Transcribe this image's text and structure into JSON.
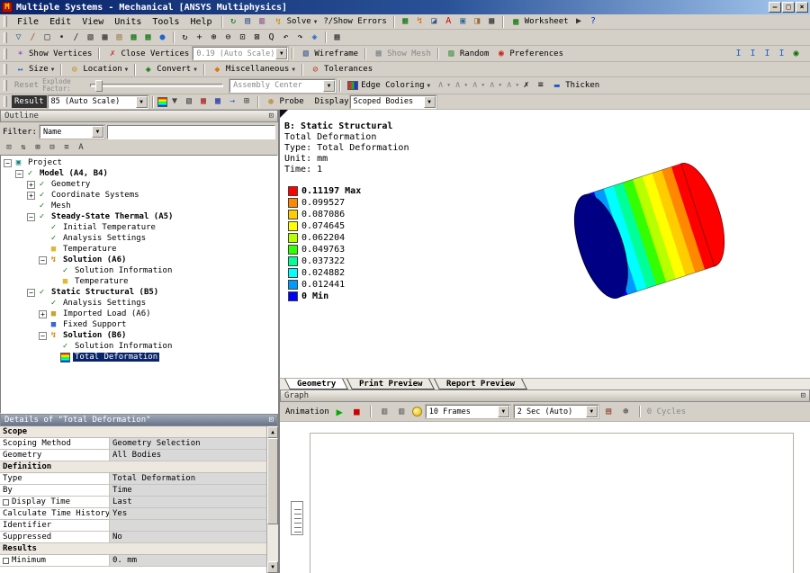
{
  "window": {
    "title": "Multiple Systems - Mechanical [ANSYS Multiphysics]"
  },
  "menus": [
    "File",
    "Edit",
    "View",
    "Units",
    "Tools",
    "Help"
  ],
  "toolbars": {
    "main": {
      "solve": "Solve",
      "show_errors": "?/Show Errors",
      "worksheet": "Worksheet"
    },
    "vertices": {
      "show_vertices": "Show Vertices",
      "close_vertices": "Close Vertices",
      "scale": "0.19 (Auto Scale)",
      "wireframe": "Wireframe",
      "show_mesh": "Show Mesh",
      "random": "Random",
      "preferences": "Preferences"
    },
    "selection": {
      "size": "Size",
      "location": "Location",
      "convert": "Convert",
      "miscellaneous": "Miscellaneous",
      "tolerances": "Tolerances"
    },
    "explode": {
      "reset": "Reset",
      "factor_label": "Explode Factor:",
      "assembly": "Assembly Center",
      "edge_coloring": "Edge Coloring",
      "thicken": "Thicken"
    },
    "result": {
      "label": "Result",
      "scale": "85 (Auto Scale)",
      "probe": "Probe",
      "display": "Display",
      "display_value": "Scoped Bodies"
    }
  },
  "icons": {
    "r1a": [
      {
        "n": "model-refresh-icon",
        "g": "↻",
        "f": "#067106"
      },
      {
        "n": "insert-object-icon",
        "g": "▤",
        "f": "#335588"
      },
      {
        "n": "chart-view-icon",
        "g": "▥",
        "f": "#884488"
      }
    ],
    "r1b": [
      {
        "n": "tools-grid-icon",
        "g": "▦",
        "f": "#067106"
      },
      {
        "n": "bolt-tool-icon",
        "g": "↯",
        "f": "#cc6600"
      },
      {
        "n": "section-plane-icon",
        "g": "◪",
        "f": "#335588"
      },
      {
        "n": "annotation-icon",
        "g": "A",
        "f": "#cc0000"
      },
      {
        "n": "snapshot-icon",
        "g": "▣",
        "f": "#336699"
      },
      {
        "n": "units-tag-icon",
        "g": "◨",
        "f": "#996633"
      },
      {
        "n": "report-chart-icon",
        "g": "▩",
        "f": "#333333"
      }
    ],
    "r1c": [
      {
        "n": "pointer-mode-icon",
        "g": "▶",
        "f": "#333333"
      },
      {
        "n": "what-is-this-icon",
        "g": "?",
        "f": "#0033cc"
      }
    ],
    "r2": [
      {
        "n": "filter-icon",
        "g": "▽",
        "f": "#336699"
      },
      {
        "n": "edit-pencil-icon",
        "g": "∕",
        "f": "#996633"
      },
      {
        "n": "select-mode-icon",
        "g": "□",
        "f": "#333333"
      },
      {
        "n": "vertex-filter-icon",
        "g": "∙",
        "f": "#333333"
      },
      {
        "n": "edge-filter-icon",
        "g": "/",
        "f": "#333333"
      },
      {
        "n": "face-filter-icon",
        "g": "▧",
        "f": "#333333"
      },
      {
        "n": "body-filter-icon",
        "g": "▩",
        "f": "#333333"
      },
      {
        "n": "clipboard-copy-icon",
        "g": "▤",
        "f": "#997744"
      },
      {
        "n": "selection-table-icon",
        "g": "▦",
        "f": "#067106"
      },
      {
        "n": "selection-info-icon",
        "g": "▦",
        "f": "#067106"
      },
      {
        "n": "globe-icon",
        "g": "●",
        "f": "#2266cc"
      },
      {
        "sep": 1
      },
      {
        "n": "rotate-view-icon",
        "g": "↻",
        "f": "#111111"
      },
      {
        "n": "pan-view-icon",
        "g": "+",
        "f": "#111111"
      },
      {
        "n": "zoom-in-icon",
        "g": "⊕",
        "f": "#111111"
      },
      {
        "n": "zoom-out-icon",
        "g": "⊖",
        "f": "#111111"
      },
      {
        "n": "box-zoom-icon",
        "g": "⊡",
        "f": "#111111"
      },
      {
        "n": "zoom-fit-icon",
        "g": "⊠",
        "f": "#111111"
      },
      {
        "n": "magnifier-icon",
        "g": "Q",
        "f": "#111111"
      },
      {
        "n": "previous-view-icon",
        "g": "↶",
        "f": "#111111"
      },
      {
        "n": "next-view-icon",
        "g": "↷",
        "f": "#111111"
      },
      {
        "n": "iso-view-icon",
        "g": "◈",
        "f": "#2266cc"
      },
      {
        "sep": 1
      },
      {
        "n": "viewports-icon",
        "g": "▦",
        "f": "#333333"
      }
    ],
    "r3r": [
      {
        "n": "beam-display-icon",
        "g": "I",
        "f": "#2266cc"
      },
      {
        "n": "beam-section-icon",
        "g": "I",
        "f": "#2266cc"
      },
      {
        "n": "beam-orientation-icon",
        "g": "I",
        "f": "#2266cc"
      },
      {
        "n": "beam-results-icon",
        "g": "I",
        "f": "#2266cc"
      },
      {
        "n": "connections-icon",
        "g": "◉",
        "f": "#067106"
      }
    ],
    "r6": [
      {
        "n": "contour-bands-icon",
        "rainbow": 1
      },
      {
        "n": "contour-mode-icon",
        "g": "▼",
        "f": "#444444"
      },
      {
        "n": "geometry-display-icon",
        "g": "▧",
        "f": "#444444"
      },
      {
        "n": "max-annotation-icon",
        "g": "▦",
        "f": "#aa2222"
      },
      {
        "n": "min-annotation-icon",
        "g": "▦",
        "f": "#2233aa"
      },
      {
        "n": "vector-plot-icon",
        "g": "→",
        "f": "#2266cc"
      },
      {
        "n": "solution-combo-icon",
        "g": "⊞",
        "f": "#444444"
      }
    ],
    "outline_tools": [
      {
        "n": "show-details-icon",
        "g": "⊡",
        "f": "#333333"
      },
      {
        "n": "sort-items-icon",
        "g": "⇅",
        "f": "#333333"
      },
      {
        "n": "expand-all-icon",
        "g": "⊞",
        "f": "#333333"
      },
      {
        "n": "collapse-all-icon",
        "g": "⊟",
        "f": "#333333"
      },
      {
        "n": "flat-view-icon",
        "g": "≡",
        "f": "#333333"
      },
      {
        "n": "name-sort-icon",
        "g": "A",
        "f": "#333333"
      }
    ]
  },
  "tree_icon_defs": {
    "project": {
      "g": "▣",
      "f": "#18867e"
    },
    "model": {
      "g": "✓",
      "f": "#067106"
    },
    "geometry": {
      "g": "✓",
      "f": "#067106"
    },
    "csys": {
      "g": "✓",
      "f": "#067106"
    },
    "mesh": {
      "g": "✓",
      "f": "#067106"
    },
    "thermal": {
      "g": "✓",
      "f": "#067106"
    },
    "inittemp": {
      "g": "✓",
      "f": "#067106"
    },
    "settings": {
      "g": "✓",
      "f": "#067106"
    },
    "tempload": {
      "g": "■",
      "f": "#e0b838"
    },
    "solution": {
      "g": "↯",
      "f": "#cc8800"
    },
    "solinfo": {
      "g": "✓",
      "f": "#067106"
    },
    "tempresult": {
      "g": "■",
      "f": "#e0b838"
    },
    "structural": {
      "g": "✓",
      "f": "#067106"
    },
    "imported": {
      "g": "■",
      "f": "#c8a430"
    },
    "support": {
      "g": "■",
      "f": "#3a66d0"
    },
    "result": {
      "rainbow": 1
    }
  },
  "outline": {
    "title": "Outline",
    "filter_label": "Filter:",
    "filter_value": "Name",
    "tree": [
      {
        "label": "Project",
        "level": 0,
        "expand": "-",
        "icon": "project"
      },
      {
        "label": "Model (A4, B4)",
        "level": 1,
        "expand": "-",
        "icon": "model",
        "bold": true
      },
      {
        "label": "Geometry",
        "level": 2,
        "expand": "+",
        "icon": "geometry"
      },
      {
        "label": "Coordinate Systems",
        "level": 2,
        "expand": "+",
        "icon": "csys"
      },
      {
        "label": "Mesh",
        "level": 2,
        "icon": "mesh"
      },
      {
        "label": "Steady-State Thermal (A5)",
        "level": 2,
        "expand": "-",
        "icon": "thermal",
        "bold": true
      },
      {
        "label": "Initial Temperature",
        "level": 3,
        "icon": "inittemp"
      },
      {
        "label": "Analysis Settings",
        "level": 3,
        "icon": "settings"
      },
      {
        "label": "Temperature",
        "level": 3,
        "icon": "tempload"
      },
      {
        "label": "Solution (A6)",
        "level": 3,
        "expand": "-",
        "icon": "solution",
        "bold": true
      },
      {
        "label": "Solution Information",
        "level": 4,
        "icon": "solinfo"
      },
      {
        "label": "Temperature",
        "level": 4,
        "icon": "tempresult"
      },
      {
        "label": "Static Structural (B5)",
        "level": 2,
        "expand": "-",
        "icon": "structural",
        "bold": true
      },
      {
        "label": "Analysis Settings",
        "level": 3,
        "icon": "settings"
      },
      {
        "label": "Imported Load (A6)",
        "level": 3,
        "expand": "+",
        "icon": "imported"
      },
      {
        "label": "Fixed Support",
        "level": 3,
        "icon": "support"
      },
      {
        "label": "Solution (B6)",
        "level": 3,
        "expand": "-",
        "icon": "solution",
        "bold": true
      },
      {
        "label": "Solution Information",
        "level": 4,
        "icon": "solinfo"
      },
      {
        "label": "Total Deformation",
        "level": 4,
        "icon": "result",
        "selected": true
      }
    ]
  },
  "details": {
    "title": "Details of \"Total Deformation\"",
    "rows": [
      {
        "type": "section",
        "label": "Scope"
      },
      {
        "label": "Scoping Method",
        "value": "Geometry Selection"
      },
      {
        "label": "Geometry",
        "value": "All Bodies"
      },
      {
        "type": "section",
        "label": "Definition"
      },
      {
        "label": "Type",
        "value": "Total Deformation"
      },
      {
        "label": "By",
        "value": "Time"
      },
      {
        "label": "Display Time",
        "value": "Last",
        "checkbox": true
      },
      {
        "label": "Calculate Time History",
        "value": "Yes"
      },
      {
        "label": "Identifier",
        "value": ""
      },
      {
        "label": "Suppressed",
        "value": "No"
      },
      {
        "type": "section",
        "label": "Results"
      },
      {
        "label": "Minimum",
        "value": "0. mm",
        "checkbox": true
      }
    ]
  },
  "viewport": {
    "legend": {
      "lines": [
        "B: Static Structural",
        "Total Deformation",
        "Type: Total Deformation",
        "Unit: mm",
        "Time: 1"
      ],
      "scale": [
        {
          "value": "0.11197 Max",
          "color": "#ff0000",
          "bold": true
        },
        {
          "value": "0.099527",
          "color": "#ff8800"
        },
        {
          "value": "0.087086",
          "color": "#ffcc00"
        },
        {
          "value": "0.074645",
          "color": "#ffff00"
        },
        {
          "value": "0.062204",
          "color": "#b8ff00"
        },
        {
          "value": "0.049763",
          "color": "#33ff00"
        },
        {
          "value": "0.037322",
          "color": "#00ff99"
        },
        {
          "value": "0.024882",
          "color": "#00ffff"
        },
        {
          "value": "0.012441",
          "color": "#0099ff"
        },
        {
          "value": "0 Min",
          "color": "#0000ff",
          "bold": true
        }
      ]
    },
    "tabs": [
      {
        "label": "Geometry",
        "active": true
      },
      {
        "label": "Print Preview"
      },
      {
        "label": "Report Preview"
      }
    ]
  },
  "graph": {
    "title": "Graph",
    "animation": "Animation",
    "frames": "10 Frames",
    "duration": "2 Sec (Auto)",
    "cycles": "0 Cycles"
  }
}
